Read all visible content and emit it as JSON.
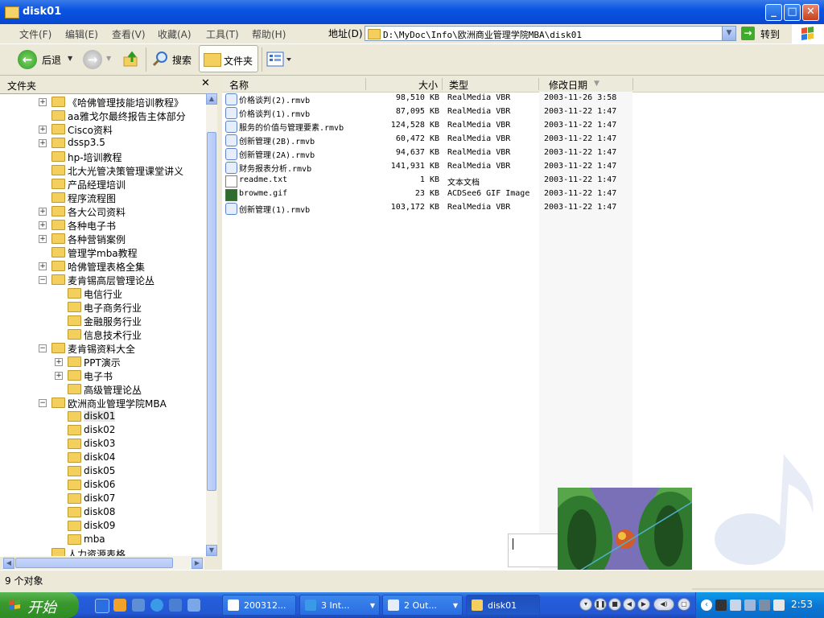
{
  "window": {
    "title": "disk01"
  },
  "menu": {
    "items": [
      "文件(F)",
      "编辑(E)",
      "查看(V)",
      "收藏(A)",
      "工具(T)",
      "帮助(H)"
    ],
    "address_label": "地址(D)",
    "address_value": "D:\\MyDoc\\Info\\欧洲商业管理学院MBA\\disk01",
    "go_label": "转到"
  },
  "toolbar": {
    "back_label": "后退",
    "search_label": "搜索",
    "folders_label": "文件夹"
  },
  "folder_pane": {
    "title": "文件夹",
    "close_glyph": "✕",
    "tree": [
      {
        "label": "《哈佛管理技能培训教程》",
        "expander": "+",
        "level": 1
      },
      {
        "label": "aa雅戈尔最终报告主体部分",
        "expander": "",
        "level": 1
      },
      {
        "label": "Cisco资料",
        "expander": "+",
        "level": 1
      },
      {
        "label": "dssp3.5",
        "expander": "+",
        "level": 1
      },
      {
        "label": "hp-培训教程",
        "expander": "",
        "level": 1
      },
      {
        "label": "北大光管决策管理课堂讲义",
        "expander": "",
        "level": 1
      },
      {
        "label": "产品经理培训",
        "expander": "",
        "level": 1
      },
      {
        "label": "程序流程图",
        "expander": "",
        "level": 1
      },
      {
        "label": "各大公司资料",
        "expander": "+",
        "level": 1
      },
      {
        "label": "各种电子书",
        "expander": "+",
        "level": 1
      },
      {
        "label": "各种营销案例",
        "expander": "+",
        "level": 1
      },
      {
        "label": "管理学mba教程",
        "expander": "",
        "level": 1
      },
      {
        "label": "哈佛管理表格全集",
        "expander": "+",
        "level": 1
      },
      {
        "label": "麦肯锡高层管理论丛",
        "expander": "−",
        "level": 1
      },
      {
        "label": "电信行业",
        "expander": "",
        "level": 2
      },
      {
        "label": "电子商务行业",
        "expander": "",
        "level": 2
      },
      {
        "label": "金融服务行业",
        "expander": "",
        "level": 2
      },
      {
        "label": "信息技术行业",
        "expander": "",
        "level": 2
      },
      {
        "label": "麦肯锡资料大全",
        "expander": "−",
        "level": 1
      },
      {
        "label": "PPT演示",
        "expander": "+",
        "level": 2
      },
      {
        "label": "电子书",
        "expander": "+",
        "level": 2
      },
      {
        "label": "高级管理论丛",
        "expander": "",
        "level": 2
      },
      {
        "label": "欧洲商业管理学院MBA",
        "expander": "−",
        "level": 1
      },
      {
        "label": "disk01",
        "expander": "",
        "level": 2,
        "selected": true
      },
      {
        "label": "disk02",
        "expander": "",
        "level": 2
      },
      {
        "label": "disk03",
        "expander": "",
        "level": 2
      },
      {
        "label": "disk04",
        "expander": "",
        "level": 2
      },
      {
        "label": "disk05",
        "expander": "",
        "level": 2
      },
      {
        "label": "disk06",
        "expander": "",
        "level": 2
      },
      {
        "label": "disk07",
        "expander": "",
        "level": 2
      },
      {
        "label": "disk08",
        "expander": "",
        "level": 2
      },
      {
        "label": "disk09",
        "expander": "",
        "level": 2
      },
      {
        "label": "mba",
        "expander": "",
        "level": 2
      },
      {
        "label": "人力资源表格",
        "expander": "",
        "level": 1
      }
    ]
  },
  "file_list": {
    "columns": {
      "name": "名称",
      "size": "大小",
      "type": "类型",
      "modified": "修改日期",
      "sort_glyph": "▼"
    },
    "files": [
      {
        "name": "价格谈判(2).rmvb",
        "size": "98,510 KB",
        "type": "RealMedia VBR",
        "modified": "2003-11-26 3:58",
        "icon": "realmedia-file-icon"
      },
      {
        "name": "价格谈判(1).rmvb",
        "size": "87,095 KB",
        "type": "RealMedia VBR",
        "modified": "2003-11-22 1:47",
        "icon": "realmedia-file-icon"
      },
      {
        "name": "服务的价值与管理要素.rmvb",
        "size": "124,528 KB",
        "type": "RealMedia VBR",
        "modified": "2003-11-22 1:47",
        "icon": "realmedia-file-icon"
      },
      {
        "name": "创新管理(2B).rmvb",
        "size": "60,472 KB",
        "type": "RealMedia VBR",
        "modified": "2003-11-22 1:47",
        "icon": "realmedia-file-icon"
      },
      {
        "name": "创新管理(2A).rmvb",
        "size": "94,637 KB",
        "type": "RealMedia VBR",
        "modified": "2003-11-22 1:47",
        "icon": "realmedia-file-icon"
      },
      {
        "name": "财务报表分析.rmvb",
        "size": "141,931 KB",
        "type": "RealMedia VBR",
        "modified": "2003-11-22 1:47",
        "icon": "realmedia-file-icon"
      },
      {
        "name": "readme.txt",
        "size": "1 KB",
        "type": "文本文档",
        "modified": "2003-11-22 1:47",
        "icon": "text-file-icon"
      },
      {
        "name": "browme.gif",
        "size": "23 KB",
        "type": "ACDSee6 GIF Image",
        "modified": "2003-11-22 1:47",
        "icon": "gif-file-icon"
      },
      {
        "name": "创新管理(1).rmvb",
        "size": "103,172 KB",
        "type": "RealMedia VBR",
        "modified": "2003-11-22 1:47",
        "icon": "realmedia-file-icon"
      }
    ]
  },
  "statusbar": {
    "text": "9 个对象"
  },
  "taskbar": {
    "start_label": "开始",
    "tasks": [
      {
        "label": "200312...",
        "icon": "word-doc-icon",
        "has_dropdown": false
      },
      {
        "label": "3 Int...",
        "icon": "ie-icon",
        "has_dropdown": true
      },
      {
        "label": "2 Out...",
        "icon": "explorer-icon",
        "has_dropdown": true
      },
      {
        "label": "disk01",
        "icon": "folder-icon",
        "has_dropdown": false,
        "active": true
      }
    ],
    "clock": "2:53"
  },
  "colors": {
    "title_bar": "#0a54e3",
    "taskbar": "#245edb",
    "start_green": "#3a9a2e",
    "sort_column_bg": "#f7f7f7",
    "selection": "#e8e8e8"
  }
}
